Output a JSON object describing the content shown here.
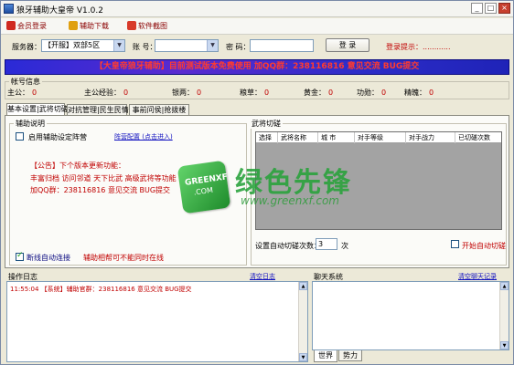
{
  "window": {
    "title": "狼牙辅助大皇帝 V1.0.2",
    "btn_min": "_",
    "btn_max": "□",
    "btn_close": "×"
  },
  "toolbar": {
    "items": [
      {
        "label": "会员登录",
        "icon_color": "#d02a20"
      },
      {
        "label": "辅助下载",
        "icon_color": "#e0a010"
      },
      {
        "label": "软件截图",
        "icon_color": "#d83a2a"
      }
    ]
  },
  "login": {
    "server_label": "服务器：",
    "server_value": "【开服】双部5区",
    "account_label": "账 号：",
    "account_value": "",
    "password_label": "密 码：",
    "password_value": "",
    "login_button": "登  录",
    "login_hint": "登录提示：............"
  },
  "banner": {
    "text": "【大皇帝狼牙辅助】目前测试版本免费使用    加QQ群：238116816  意见交流  BUG提交"
  },
  "account_info": {
    "title": "帐号信息",
    "stats": [
      {
        "label": "主公：",
        "value": "0"
      },
      {
        "label": "主公经验：",
        "value": "0"
      },
      {
        "label": "银两：",
        "value": "0"
      },
      {
        "label": "粮草：",
        "value": "0"
      },
      {
        "label": "黄金：",
        "value": "0"
      },
      {
        "label": "功勋：",
        "value": "0"
      },
      {
        "label": "精魄：",
        "value": "0"
      }
    ]
  },
  "tabs": [
    "基本设置|武将切磋",
    "对抗管理|民生民情",
    "事前问侯|抢拨楼"
  ],
  "help": {
    "title": "辅助说明",
    "enable_label": "启用辅助设定阵营",
    "enable_checked": false,
    "link_text": "阵营配置 (点击进入)",
    "notice_title": "【公告】下个版本更新功能：",
    "notice_lines": [
      "丰富归档    访问邻道    天下比武    高级武将等功能",
      "加QQ群：238116816  意见交流  BUG提交"
    ],
    "auto_login_label": "断线自动连接",
    "auto_login_checked": true,
    "auto_login_note": "辅助相帮可不能同时在线"
  },
  "generals": {
    "title": "武将切磋",
    "columns": [
      "选择",
      "武将名称",
      "城  市",
      "对手等级",
      "对手战力",
      "已切磋次数"
    ],
    "auto_count_label": "设置自动切磋次数：",
    "auto_count_value": "3",
    "auto_count_unit": "次",
    "start_label": "开始自动切磋",
    "start_checked": false
  },
  "oplog": {
    "title": "操作日志",
    "clear_link": "清空日志",
    "lines": [
      "11:55:04 【系统】辅助官群：238116816  意见交流  BUG提交"
    ]
  },
  "chat": {
    "title": "聊天系统",
    "clear_link": "清空聊天记录",
    "tabs": [
      "世界",
      "势力"
    ]
  },
  "watermark": {
    "logo_line1": "GREENXF",
    "logo_line2": ".COM",
    "text": "绿色先锋",
    "url": "www.greenxf.com"
  }
}
